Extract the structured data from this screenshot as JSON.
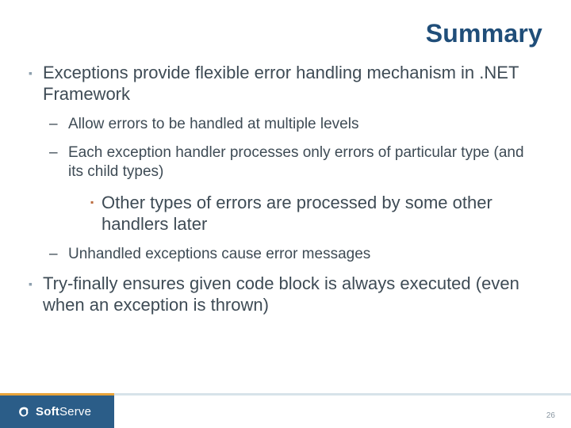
{
  "title": "Summary",
  "bullets": {
    "b1": "Exceptions provide flexible error handling mechanism in .NET Framework",
    "b1_1": "Allow errors to be handled at multiple levels",
    "b1_2": "Each exception handler processes only errors of particular type (and its child types)",
    "b1_2_1": "Other types of errors are processed by some other handlers later",
    "b1_3": "Unhandled exceptions cause error messages",
    "b2": "Try-finally ensures given code block is always executed (even when an exception is thrown)"
  },
  "footer": {
    "brand_prefix": "Soft",
    "brand_suffix": "Serve",
    "page_number": "26"
  },
  "colors": {
    "title": "#204e79",
    "footer_blue": "#2b5d88",
    "footer_orange": "#e8a33a"
  }
}
